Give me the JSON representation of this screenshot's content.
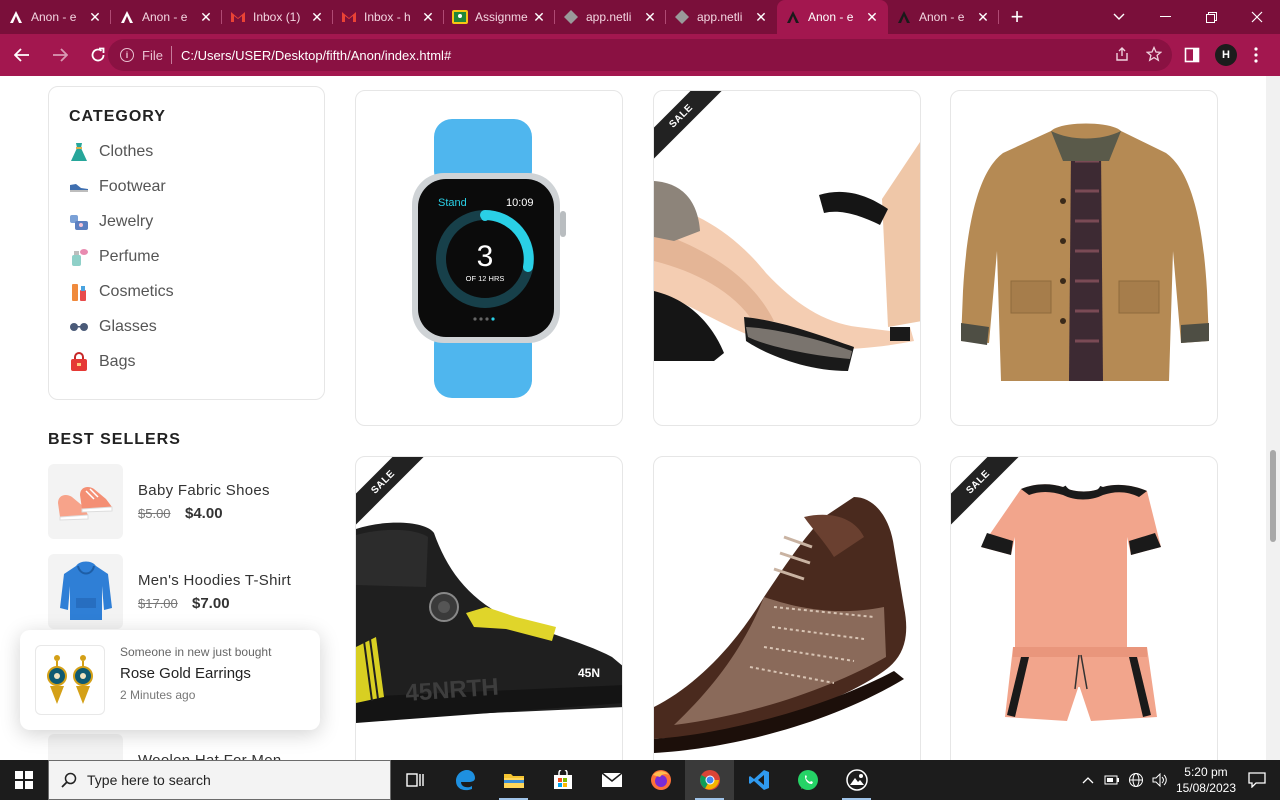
{
  "browser": {
    "tabs": [
      {
        "label": "Anon - e",
        "fav": "anon"
      },
      {
        "label": "Anon - e",
        "fav": "anon"
      },
      {
        "label": "Inbox (1)",
        "fav": "gmail"
      },
      {
        "label": "Inbox - h",
        "fav": "gmail"
      },
      {
        "label": "Assignme",
        "fav": "classroom"
      },
      {
        "label": "app.netli",
        "fav": "netlify"
      },
      {
        "label": "app.netli",
        "fav": "netlify"
      },
      {
        "label": "Anon - e",
        "fav": "anon",
        "active": true
      },
      {
        "label": "Anon - e",
        "fav": "anon"
      }
    ],
    "address_scheme": "File",
    "address_url": "C:/Users/USER/Desktop/fifth/Anon/index.html#",
    "profile_initial": "H"
  },
  "sidebar": {
    "category_title": "CATEGORY",
    "categories": [
      "Clothes",
      "Footwear",
      "Jewelry",
      "Perfume",
      "Cosmetics",
      "Glasses",
      "Bags"
    ],
    "best_sellers_title": "BEST SELLERS",
    "best_sellers": [
      {
        "name": "Baby Fabric Shoes",
        "old_price": "$5.00",
        "price": "$4.00"
      },
      {
        "name": "Men's Hoodies T-Shirt",
        "old_price": "$17.00",
        "price": "$7.00"
      },
      {
        "name": "Woolen Hat For Men"
      }
    ]
  },
  "toast": {
    "line1": "Someone in new just bought",
    "product": "Rose Gold Earrings",
    "time": "2 Minutes ago"
  },
  "products": {
    "sale_badge": "SALE",
    "watch_face": {
      "label": "Stand",
      "time": "10:09",
      "big": "3",
      "sub": "OF 12 HRS"
    },
    "shoe_brand": "45NRTH",
    "shoe_logo": "45N"
  },
  "taskbar": {
    "search_placeholder": "Type here to search",
    "time": "5:20 pm",
    "date": "15/08/2023"
  },
  "colors": {
    "tab_bar": "#7a0f3a",
    "toolbar": "#a3174f",
    "sale_badge": "#222222"
  }
}
